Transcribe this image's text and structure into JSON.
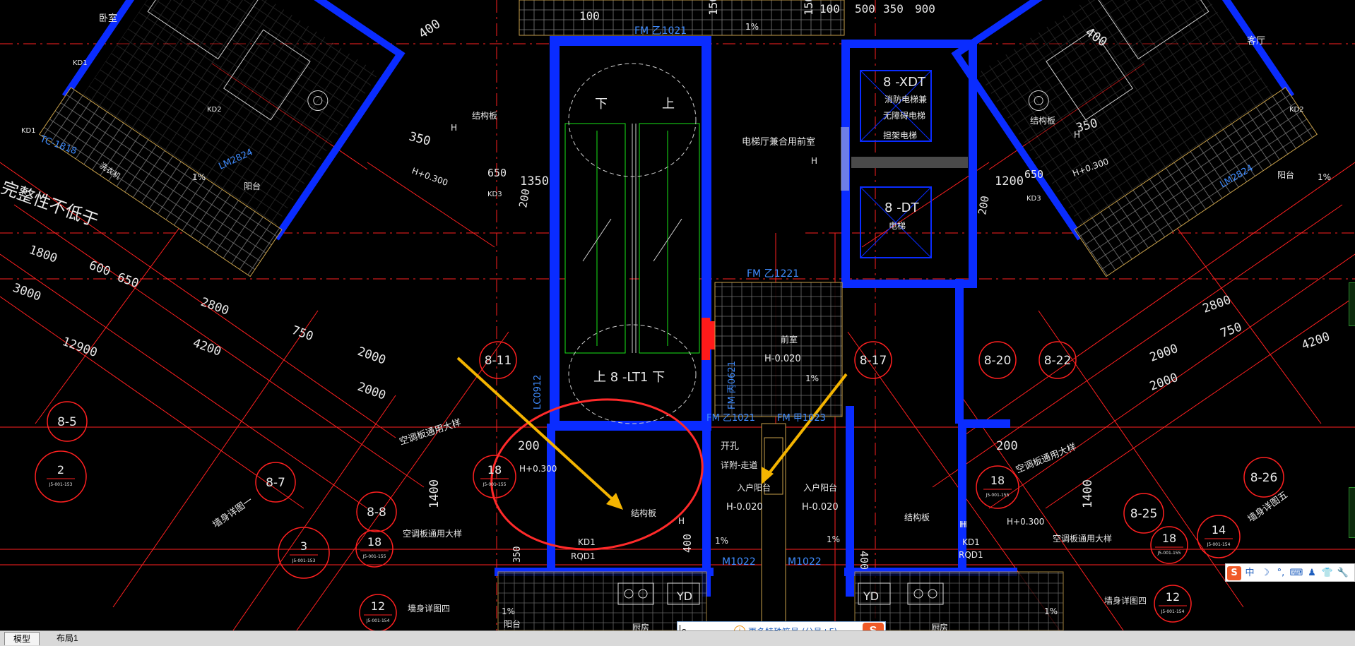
{
  "tabs": [
    {
      "label": "模型",
      "active": true
    },
    {
      "label": "布局1",
      "active": false
    }
  ],
  "ime": {
    "input": "s",
    "hint": "更多特殊符号 (分号+F)",
    "logo": "S",
    "status_items": [
      "S",
      "中",
      "☽",
      "°,",
      "⌨",
      "♟",
      "👕",
      "🔧"
    ]
  },
  "colors": {
    "background": "#000000",
    "wall": "#0a2cff",
    "axis_lines": "#ff2020",
    "arrow": "#f4b400",
    "highlight_ellipse": "#ff2a2a",
    "text": "#e8e8e8",
    "label_blue": "#3f8cff"
  },
  "drawing": {
    "room_labels": {
      "bedroom_tl": "卧室",
      "living_tr": "客厅",
      "struct_l": "结构板",
      "struct_r": "结构板",
      "struct_mid": "结构板",
      "struct_br": "结构板",
      "balcony_l": "阳台",
      "balcony_r": "阳台",
      "elevator_lobby": "电梯厅兼合用前室",
      "front_room": "前室",
      "fire_elevator": "消防电梯兼",
      "barrier_free": "无障碍电梯",
      "stretcher": "担架电梯",
      "elevator": "电梯",
      "entry_balcony_l": "入户阳台",
      "entry_balcony_r": "入户阳台",
      "kitchen_l": "厨房",
      "kitchen_r": "厨房",
      "balcony_bl": "阳台",
      "laundry": "洗衣机",
      "integrity": "完整性不低于",
      "wall_detail_l": "墙身详图一",
      "wall_detail_r": "墙身详图五",
      "wall_detail_b": "墙身详图四",
      "wall_detail_br": "墙身详图四",
      "ac_board_l": "空调板通用大样",
      "ac_board_l2": "空调板通用大样",
      "ac_board_r": "空调板通用大样",
      "ac_board_r2": "空调板通用大样",
      "kaikong": "开孔",
      "detail_ref": "详附-走道"
    },
    "tags": {
      "xdt": "8 -XDT",
      "dt": "8 -DT",
      "lt1": "上 8 -LT1 下",
      "down": "下",
      "up": "上",
      "down2": "下",
      "fm1": "FM 乙1021",
      "fm2": "FM 乙1221",
      "fm3": "FM 丙0621",
      "fm4": "FM 乙1021",
      "fm5": "FM 甲1023",
      "lm_l": "LM2824",
      "lm_r": "LM2824",
      "tc": "TC-1818",
      "lc": "LC0912",
      "m1": "M1022",
      "m2": "M1022",
      "kd1a": "KD1",
      "kd1b": "KD1",
      "kd2": "KD2",
      "kd2r": "KD2",
      "kd3": "KD3",
      "kd3r": "KD3",
      "kd1_mid": "KD1",
      "rqd1": "RQD1",
      "kd1_r": "KD1",
      "rqd1_r": "RQD1",
      "yd_l": "YD",
      "yd_r": "YD",
      "h1": "H+0.300",
      "h2": "H+0.300",
      "h3": "H+0.300",
      "h4": "H+0.300",
      "h5": "H-0.020",
      "h6": "H-0.020",
      "h7": "H-0.020",
      "h_l": "H",
      "h_r": "H",
      "h_mid": "H",
      "h_bl": "H",
      "h_br": "H",
      "h_lobby": "H",
      "slope1": "1%",
      "slope2": "1%",
      "slope3": "1%",
      "slope4": "1%",
      "slope5": "1%",
      "slope6": "1%",
      "slope7": "1%",
      "slope8": "1%"
    },
    "dimensions": [
      "100",
      "150",
      "150",
      "100",
      "500",
      "350",
      "900",
      "400",
      "400",
      "350",
      "350",
      "650",
      "1350",
      "200",
      "1200",
      "650",
      "200",
      "1800",
      "600",
      "650",
      "3000",
      "2800",
      "750",
      "4200",
      "12900",
      "2000",
      "2000",
      "2800",
      "750",
      "4200",
      "2000",
      "2000",
      "200",
      "200",
      "1400",
      "1400",
      "350",
      "400",
      "400"
    ],
    "axis_bubbles": [
      "8-5",
      "8-7",
      "8-8",
      "8-11",
      "8-17",
      "8-20",
      "8-22",
      "8-25",
      "8-26"
    ],
    "detail_bubbles": [
      {
        "num": "2",
        "ref": "J5-001-153"
      },
      {
        "num": "3",
        "ref": "J5-001-153"
      },
      {
        "num": "18",
        "ref": "J5-001-155"
      },
      {
        "num": "18",
        "ref": "J5-001-155"
      },
      {
        "num": "18",
        "ref": "J5-001-155"
      },
      {
        "num": "12",
        "ref": "J5-001-154"
      },
      {
        "num": "12",
        "ref": "J5-001-154"
      },
      {
        "num": "14",
        "ref": "J5-001-154"
      },
      {
        "num": "18",
        "ref": "J5-001-155"
      }
    ]
  }
}
